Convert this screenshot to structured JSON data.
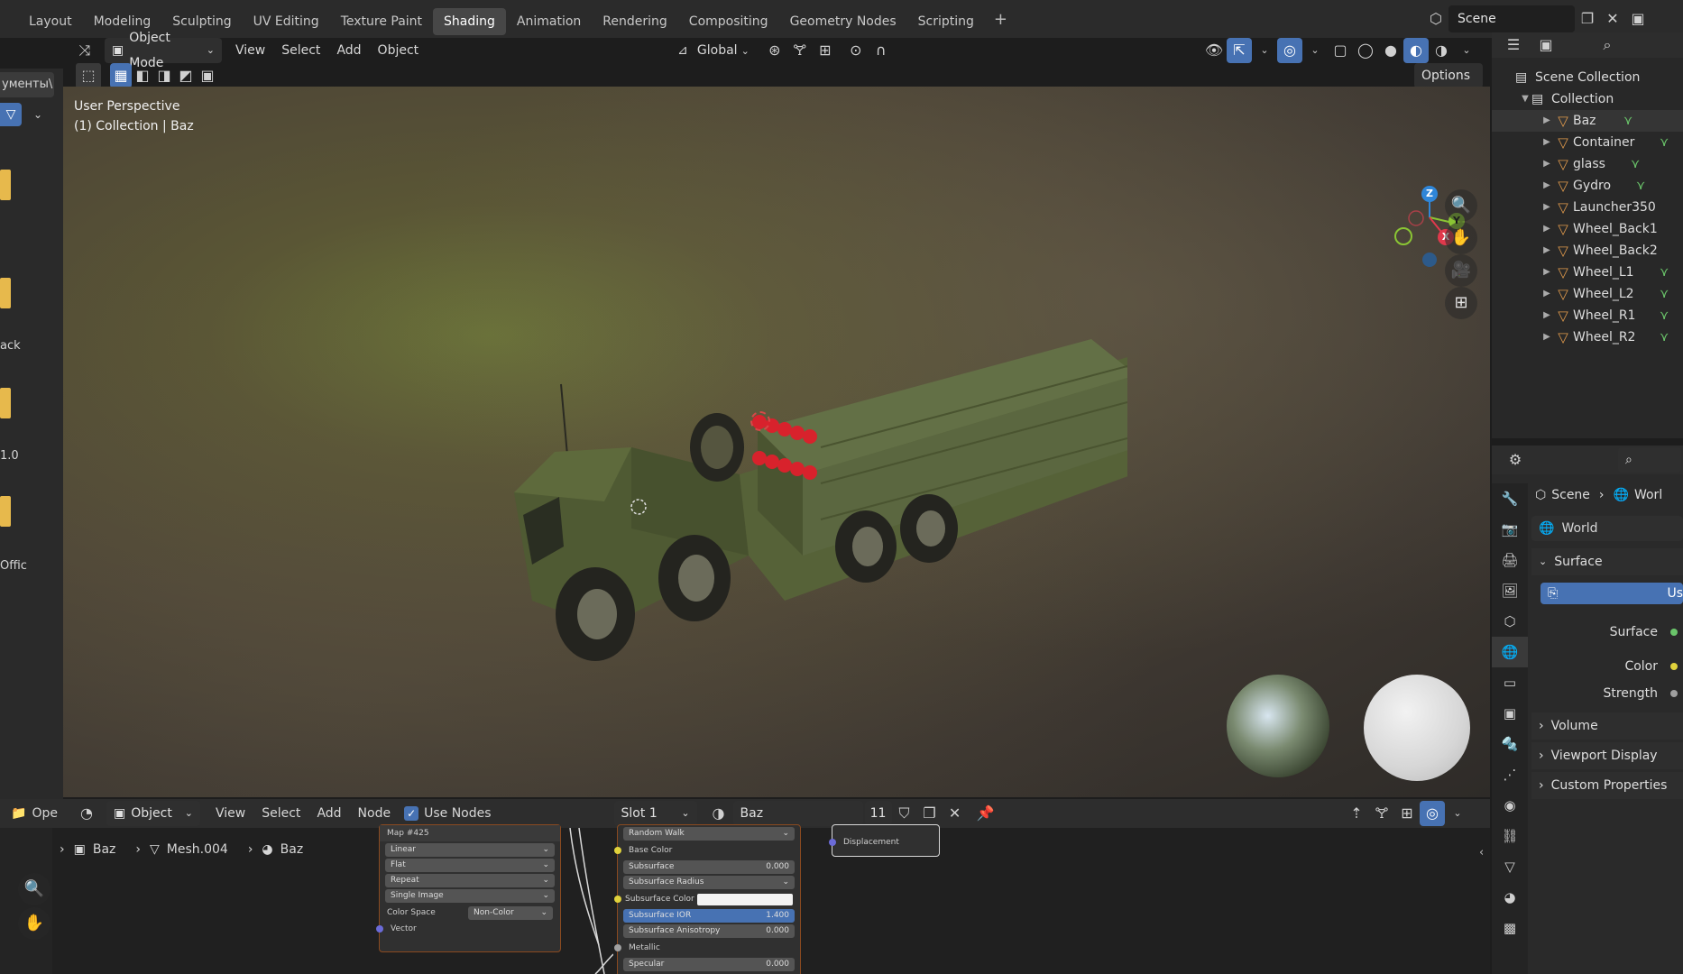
{
  "workspace_tabs": [
    "Layout",
    "Modeling",
    "Sculpting",
    "UV Editing",
    "Texture Paint",
    "Shading",
    "Animation",
    "Rendering",
    "Compositing",
    "Geometry Nodes",
    "Scripting"
  ],
  "active_tab": "Shading",
  "scene_name": "Scene",
  "viewport_header": {
    "mode": "Object Mode",
    "menus": [
      "View",
      "Select",
      "Add",
      "Object"
    ],
    "transform_orientation": "Global",
    "options_label": "Options"
  },
  "viewport": {
    "perspective_label": "User Perspective",
    "collection_label": "(1) Collection | Baz",
    "axes": {
      "z": "Z",
      "y": "Y",
      "x": "X"
    }
  },
  "left_strip": {
    "partial_labels": [
      "ументы\\",
      "ack",
      "1.0",
      "Offic"
    ],
    "open_label": "Ope"
  },
  "outliner": {
    "root": "Scene Collection",
    "collection": "Collection",
    "items": [
      {
        "name": "Baz"
      },
      {
        "name": "Container"
      },
      {
        "name": "glass"
      },
      {
        "name": "Gydro"
      },
      {
        "name": "Launcher350"
      },
      {
        "name": "Wheel_Back1"
      },
      {
        "name": "Wheel_Back2"
      },
      {
        "name": "Wheel_L1"
      },
      {
        "name": "Wheel_L2"
      },
      {
        "name": "Wheel_R1"
      },
      {
        "name": "Wheel_R2"
      }
    ]
  },
  "properties": {
    "breadcrumb_scene": "Scene",
    "breadcrumb_world": "Worl",
    "world_name": "World",
    "surface_section": "Surface",
    "use_nodes_partial": "Us",
    "surface_label": "Surface",
    "color_label": "Color",
    "strength_label": "Strength",
    "collapsed_sections": [
      "Volume",
      "Viewport Display",
      "Custom Properties"
    ]
  },
  "node_editor": {
    "editor_type": "Object",
    "menus": [
      "View",
      "Select",
      "Add",
      "Node"
    ],
    "use_nodes_label": "Use Nodes",
    "slot": "Slot 1",
    "material": "Baz",
    "user_count": "11",
    "breadcrumb": [
      "Baz",
      "Mesh.004",
      "Baz"
    ],
    "image_node": {
      "title": "Map #425",
      "fields": [
        "Linear",
        "Flat",
        "Repeat",
        "Single Image"
      ],
      "color_space_label": "Color Space",
      "color_space_value": "Non-Color",
      "vector_label": "Vector"
    },
    "bsdf_node": {
      "subsurface_method": "Random Walk",
      "rows": [
        {
          "label": "Base Color",
          "kind": "socket"
        },
        {
          "label": "Subsurface",
          "value": "0.000"
        },
        {
          "label": "Subsurface Radius",
          "kind": "dropdown"
        },
        {
          "label": "Subsurface Color",
          "kind": "swatch"
        },
        {
          "label": "Subsurface IOR",
          "value": "1.400"
        },
        {
          "label": "Subsurface Anisotropy",
          "value": "0.000"
        },
        {
          "label": "Metallic",
          "kind": "socket"
        },
        {
          "label": "Specular",
          "value": "0.000"
        }
      ]
    },
    "output_node": {
      "socket_label": "Displacement"
    }
  },
  "colors": {
    "accent": "#4772b3",
    "mesh_icon": "#e09a4c",
    "vertex_group": "#6ac46a",
    "axis_x": "#e0394c",
    "axis_y": "#8ac534",
    "axis_z": "#2f86d8"
  }
}
